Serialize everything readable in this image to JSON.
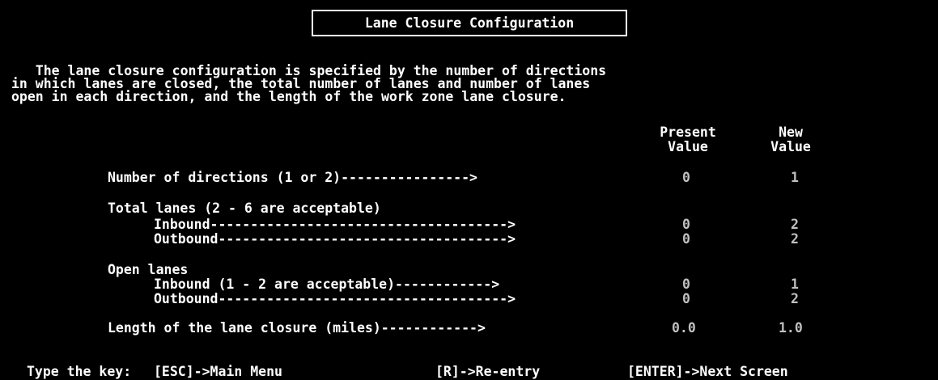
{
  "title": "Lane Closure Configuration",
  "intro": [
    "   The lane closure configuration is specified by the number of directions",
    "in which lanes are closed, the total number of lanes and number of lanes",
    "open in each direction, and the length of the work zone lane closure."
  ],
  "columns": {
    "present_line1": "Present",
    "present_line2": "Value",
    "new_line1": "New",
    "new_line2": "Value"
  },
  "fields": {
    "directions": {
      "label": "Number of directions (1 or 2)---------------->",
      "present": "0",
      "new": "1"
    },
    "total_lanes": {
      "heading": "Total lanes (2 - 6 are acceptable)",
      "inbound_label": "Inbound------------------------------------->",
      "inbound_present": "0",
      "inbound_new": "2",
      "outbound_label": "Outbound------------------------------------>",
      "outbound_present": "0",
      "outbound_new": "2"
    },
    "open_lanes": {
      "heading": "Open lanes",
      "inbound_label": "Inbound (1 - 2 are acceptable)------------>",
      "inbound_present": "0",
      "inbound_new": "1",
      "outbound_label": "Outbound------------------------------------>",
      "outbound_present": "0",
      "outbound_new": "2"
    },
    "length": {
      "label": "Length of the lane closure (miles)------------>",
      "present": "0.0",
      "new": "1.0"
    }
  },
  "footer": {
    "prompt": "Type the key:",
    "esc": "[ESC]->Main Menu",
    "reentry": "[R]->Re-entry",
    "enter": "[ENTER]->Next Screen"
  },
  "colors": {
    "background": "#000000",
    "text": "#ffffff",
    "value": "#c0c0c0"
  }
}
